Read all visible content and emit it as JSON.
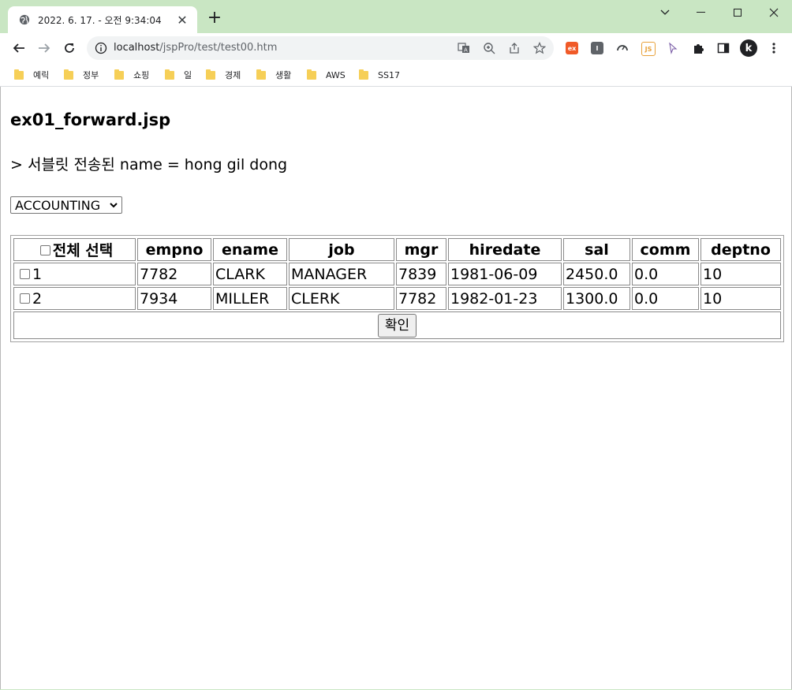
{
  "browser": {
    "tab_title": "2022. 6. 17. - 오전 9:34:04",
    "url_host": "localhost",
    "url_path": "/jspPro/test/test00.htm",
    "bookmarks": [
      {
        "label": "예릭"
      },
      {
        "label": "정부"
      },
      {
        "label": "쇼핑"
      },
      {
        "label": "일"
      },
      {
        "label": "경제"
      },
      {
        "label": "생활"
      },
      {
        "label": "AWS"
      },
      {
        "label": "SS17"
      }
    ],
    "extensions": [
      {
        "name": "ex-extension-icon",
        "text": "ex",
        "color": "#f05a28"
      },
      {
        "name": "i-extension-icon",
        "text": "I",
        "color": "#5f6368"
      },
      {
        "name": "speed-extension-icon",
        "text": "",
        "color": "#3c4043"
      },
      {
        "name": "js-extension-icon",
        "text": "JS",
        "color": "#e8a13a"
      }
    ],
    "profile_initial": "k",
    "colors": {
      "frame": "#c9e6c3",
      "folder": "#f6cf57"
    }
  },
  "page": {
    "title": "ex01_forward.jsp",
    "servlet_message": "> 서블릿 전송된 name = hong gil dong",
    "dept_select": {
      "selected": "ACCOUNTING"
    },
    "table": {
      "select_all_label": "전체 선택",
      "columns": [
        "empno",
        "ename",
        "job",
        "mgr",
        "hiredate",
        "sal",
        "comm",
        "deptno"
      ],
      "rows": [
        {
          "index": "1",
          "empno": "7782",
          "ename": "CLARK",
          "job": "MANAGER",
          "mgr": "7839",
          "hiredate": "1981-06-09",
          "sal": "2450.0",
          "comm": "0.0",
          "deptno": "10"
        },
        {
          "index": "2",
          "empno": "7934",
          "ename": "MILLER",
          "job": "CLERK",
          "mgr": "7782",
          "hiredate": "1982-01-23",
          "sal": "1300.0",
          "comm": "0.0",
          "deptno": "10"
        }
      ],
      "confirm_label": "확인"
    }
  }
}
